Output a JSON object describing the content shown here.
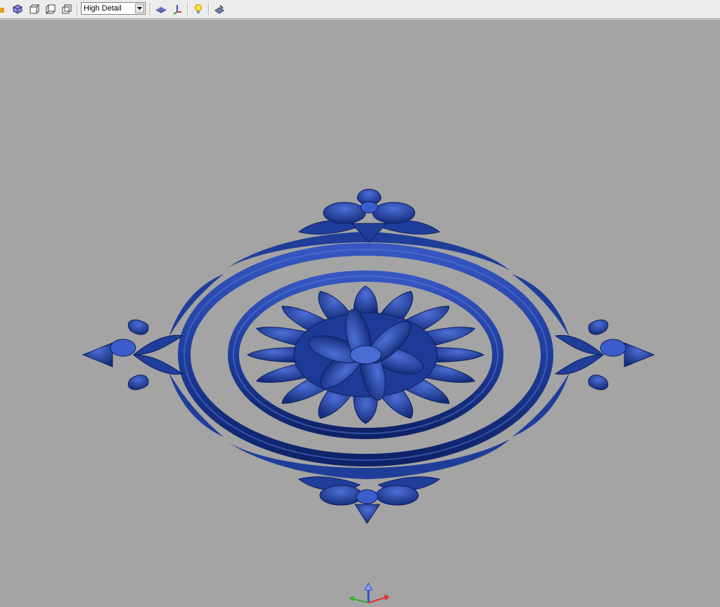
{
  "toolbar": {
    "buttons": [
      {
        "name": "iso-view-icon"
      },
      {
        "name": "front-view-icon"
      },
      {
        "name": "side-view-icon"
      },
      {
        "name": "back-view-icon"
      },
      {
        "name": "flat-shade-icon"
      },
      {
        "name": "axis-icon"
      },
      {
        "name": "light-bulb-icon"
      },
      {
        "name": "render-settings-icon"
      }
    ],
    "detail_select": {
      "value": "High Detail"
    }
  },
  "viewport": {
    "model": "rosette-relief",
    "model_color": "#1f3e9a",
    "background_color": "#a4a4a4",
    "axis_colors": {
      "x": "#e03030",
      "y": "#30b030",
      "z": "#3050d0"
    }
  }
}
